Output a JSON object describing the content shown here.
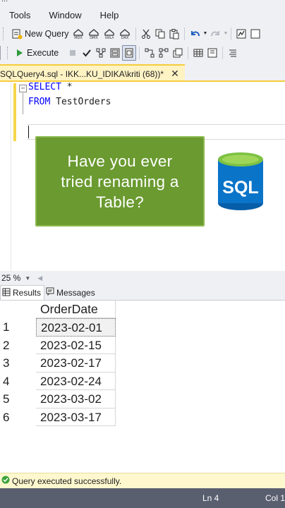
{
  "window": {
    "title_fragment": "...",
    "tab_label": "SQLQuery4.sql - IKK...KU_IDIKA\\kriti (68))*"
  },
  "menu": {
    "items": [
      "Tools",
      "Window",
      "Help"
    ]
  },
  "toolbar": {
    "new_query_label": "New Query",
    "execute_label": "Execute",
    "icons": [
      "new-query-icon",
      "mdx-icon",
      "dmx-icon",
      "xmla-icon",
      "dax-icon",
      "cut-icon",
      "copy-icon",
      "paste-icon",
      "undo-icon",
      "redo-icon",
      "execute-icon",
      "stop-icon",
      "parse-icon",
      "results-grid-icon",
      "results-text-icon",
      "comment-icon"
    ]
  },
  "editor": {
    "line1_keyword": "SELECT",
    "line1_rest": " *",
    "line2_keyword": "FROM",
    "line2_rest": " TestOrders",
    "collapse_symbol": "−"
  },
  "overlay": {
    "text": "Have you ever\ntried renaming a\nTable?",
    "logo_text": "SQL",
    "banner_color": "#6a9a30",
    "logo_color": "#0a74c9"
  },
  "zoom": {
    "value": "25 %"
  },
  "results": {
    "tabs": [
      {
        "label": "Results",
        "active": true
      },
      {
        "label": "Messages",
        "active": false
      }
    ],
    "column": "OrderDate",
    "rows": [
      {
        "num": "1",
        "value": "2023-02-01"
      },
      {
        "num": "2",
        "value": "2023-02-15"
      },
      {
        "num": "3",
        "value": "2023-02-17"
      },
      {
        "num": "4",
        "value": "2023-02-24"
      },
      {
        "num": "5",
        "value": "2023-03-02"
      },
      {
        "num": "6",
        "value": "2023-03-17"
      }
    ]
  },
  "status": {
    "message": "Query executed successfully.",
    "line": "Ln 4",
    "col": "Col 1"
  }
}
